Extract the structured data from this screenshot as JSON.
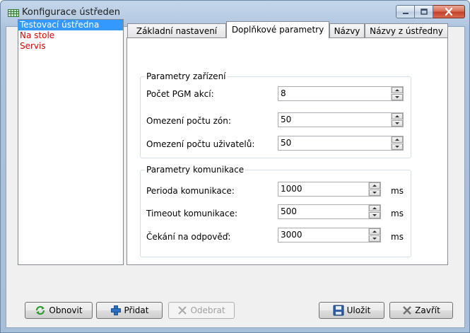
{
  "window": {
    "title": "Konfigurace ústředen"
  },
  "panels": {
    "items": [
      {
        "label": "Testovací ústředna",
        "selected": true
      },
      {
        "label": "Na stole",
        "selected": false
      },
      {
        "label": "Servis",
        "selected": false
      }
    ]
  },
  "tabs": [
    {
      "label": "Základní nastavení",
      "active": false
    },
    {
      "label": "Doplňkové parametry",
      "active": true
    },
    {
      "label": "Názvy",
      "active": false
    },
    {
      "label": "Názvy z ústředny",
      "active": false
    }
  ],
  "device_params": {
    "title": "Parametry zařízení",
    "pgm_label": "Počet PGM akcí:",
    "pgm_value": "8",
    "zones_label": "Omezení počtu zón:",
    "zones_value": "50",
    "users_label": "Omezení počtu uživatelů:",
    "users_value": "50"
  },
  "comm_params": {
    "title": "Parametry komunikace",
    "period_label": "Perioda komunikace:",
    "period_value": "1000",
    "timeout_label": "Timeout komunikace:",
    "timeout_value": "500",
    "wait_label": "Čekání na odpověď:",
    "wait_value": "3000",
    "unit": "ms"
  },
  "buttons": {
    "refresh": "Obnovit",
    "add": "Přidat",
    "remove": "Odebrat",
    "save": "Uložit",
    "close": "Zavřít"
  },
  "colors": {
    "selection": "#3399ff",
    "list_text": "#e00000",
    "close_button": "#c4412b"
  }
}
